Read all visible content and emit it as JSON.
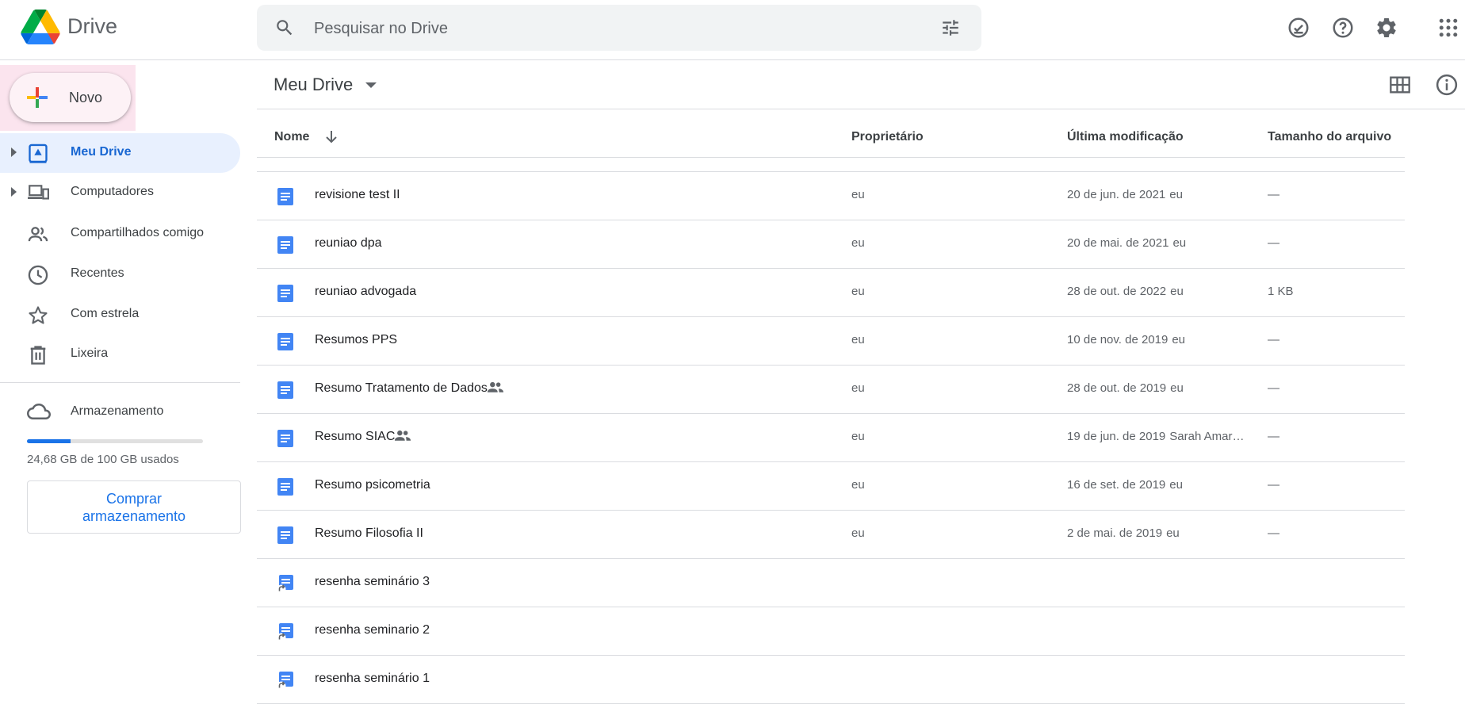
{
  "app": {
    "name": "Drive"
  },
  "search": {
    "placeholder": "Pesquisar no Drive"
  },
  "header_icons": [
    "offline-check-icon",
    "help-icon",
    "settings-icon",
    "apps-grid-icon"
  ],
  "new_button": {
    "label": "Novo"
  },
  "sidebar": {
    "items": [
      {
        "label": "Meu Drive",
        "icon": "my-drive-icon",
        "active": true,
        "expandable": true
      },
      {
        "label": "Computadores",
        "icon": "computers-icon",
        "active": false,
        "expandable": true
      },
      {
        "label": "Compartilhados comigo",
        "icon": "shared-people-icon",
        "active": false,
        "expandable": false
      },
      {
        "label": "Recentes",
        "icon": "clock-icon",
        "active": false,
        "expandable": false
      },
      {
        "label": "Com estrela",
        "icon": "star-icon",
        "active": false,
        "expandable": false
      },
      {
        "label": "Lixeira",
        "icon": "trash-icon",
        "active": false,
        "expandable": false
      }
    ]
  },
  "storage": {
    "label": "Armazenamento",
    "usage_text": "24,68 GB de 100 GB usados",
    "used_fraction": 0.2468,
    "buy_label_line1": "Comprar",
    "buy_label_line2": "armazenamento"
  },
  "main": {
    "title": "Meu Drive",
    "columns": {
      "name": "Nome",
      "owner": "Proprietário",
      "modified": "Última modificação",
      "size": "Tamanho do arquivo"
    },
    "files": [
      {
        "name": "revisione test II",
        "type": "doc",
        "shared": false,
        "owner": "eu",
        "modified": "20 de jun. de 2021",
        "modified_by": "eu",
        "size": "—"
      },
      {
        "name": "reuniao dpa",
        "type": "doc",
        "shared": false,
        "owner": "eu",
        "modified": "20 de mai. de 2021",
        "modified_by": "eu",
        "size": "—"
      },
      {
        "name": "reuniao advogada",
        "type": "doc",
        "shared": false,
        "owner": "eu",
        "modified": "28 de out. de 2022",
        "modified_by": "eu",
        "size": "1 KB"
      },
      {
        "name": "Resumos PPS",
        "type": "doc",
        "shared": false,
        "owner": "eu",
        "modified": "10 de nov. de 2019",
        "modified_by": "eu",
        "size": "—"
      },
      {
        "name": "Resumo Tratamento de Dados",
        "type": "doc",
        "shared": true,
        "owner": "eu",
        "modified": "28 de out. de 2019",
        "modified_by": "eu",
        "size": "—"
      },
      {
        "name": "Resumo SIAC",
        "type": "doc",
        "shared": true,
        "owner": "eu",
        "modified": "19 de jun. de 2019",
        "modified_by": "Sarah Amar…",
        "size": "—"
      },
      {
        "name": "Resumo psicometria",
        "type": "doc",
        "shared": false,
        "owner": "eu",
        "modified": "16 de set. de 2019",
        "modified_by": "eu",
        "size": "—"
      },
      {
        "name": "Resumo Filosofia II",
        "type": "doc",
        "shared": false,
        "owner": "eu",
        "modified": "2 de mai. de 2019",
        "modified_by": "eu",
        "size": "—"
      },
      {
        "name": "resenha seminário 3",
        "type": "doc-shortcut",
        "shared": false,
        "owner": "",
        "modified": "",
        "modified_by": "",
        "size": ""
      },
      {
        "name": "resenha seminario 2",
        "type": "doc-shortcut",
        "shared": false,
        "owner": "",
        "modified": "",
        "modified_by": "",
        "size": ""
      },
      {
        "name": "resenha seminário 1",
        "type": "doc-shortcut",
        "shared": false,
        "owner": "",
        "modified": "",
        "modified_by": "",
        "size": ""
      }
    ]
  },
  "colors": {
    "accent": "#1a73e8",
    "active_nav_bg": "#e8f0fe",
    "doc_blue": "#4285f4",
    "new_highlight": "#fbe4ee"
  }
}
